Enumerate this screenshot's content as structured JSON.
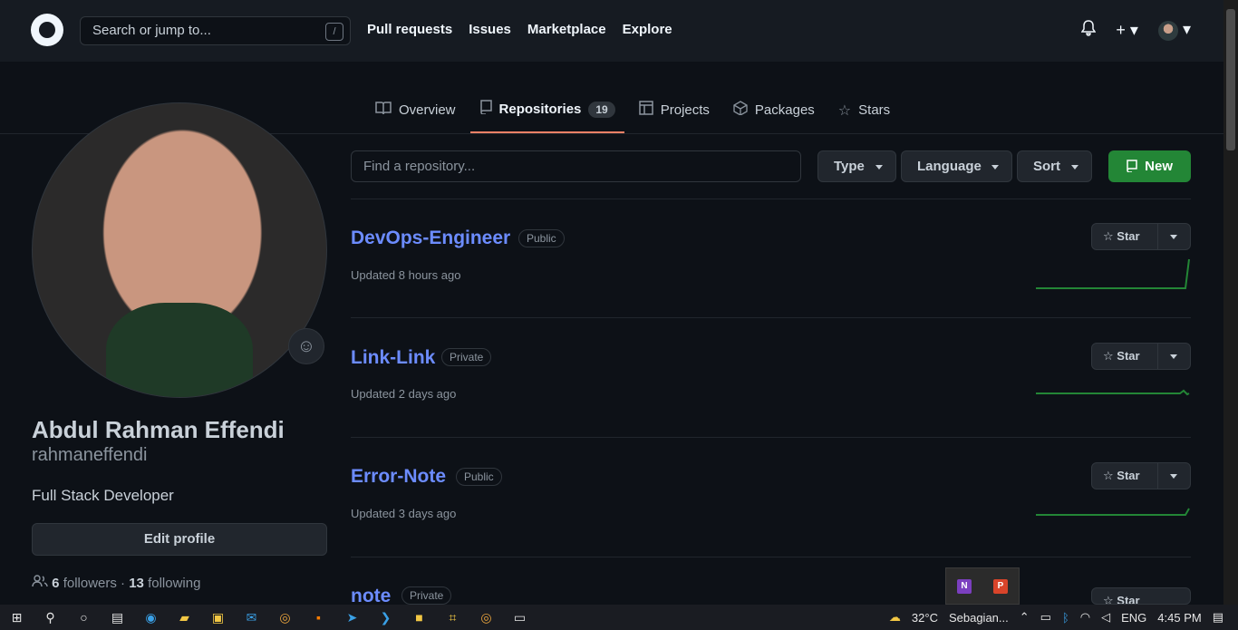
{
  "header": {
    "search_placeholder": "Search or jump to...",
    "slash_key": "/",
    "nav": [
      "Pull requests",
      "Issues",
      "Marketplace",
      "Explore"
    ]
  },
  "tabs": [
    {
      "label": "Overview",
      "icon": "book-icon"
    },
    {
      "label": "Repositories",
      "icon": "repo-icon",
      "count": "19"
    },
    {
      "label": "Projects",
      "icon": "table-icon"
    },
    {
      "label": "Packages",
      "icon": "package-icon"
    },
    {
      "label": "Stars",
      "icon": "star-icon"
    }
  ],
  "profile": {
    "name": "Abdul Rahman Effendi",
    "login": "rahmaneffendi",
    "bio": "Full Stack Developer",
    "edit_label": "Edit profile",
    "followers_count": "6",
    "followers_label": "followers",
    "separator": "·",
    "following_count": "13",
    "following_label": "following"
  },
  "filter": {
    "find_placeholder": "Find a repository...",
    "type_label": "Type",
    "language_label": "Language",
    "sort_label": "Sort",
    "new_label": "New"
  },
  "repos": [
    {
      "name": "DevOps-Engineer",
      "visibility": "Public",
      "updated": "Updated 8 hours ago",
      "star_label": "Star"
    },
    {
      "name": "Link-Link",
      "visibility": "Private",
      "updated": "Updated 2 days ago",
      "star_label": "Star"
    },
    {
      "name": "Error-Note",
      "visibility": "Public",
      "updated": "Updated 3 days ago",
      "star_label": "Star"
    },
    {
      "name": "note",
      "visibility": "Private",
      "updated": "",
      "star_label": "Star"
    }
  ],
  "taskbar": {
    "weather": "32°C",
    "weather_desc": "Sebagian...",
    "lang": "ENG",
    "time": "4:45 PM",
    "popup_icons": [
      "N",
      "P"
    ]
  },
  "colors": {
    "accent_link": "#6c8cff",
    "new_button": "#238636",
    "active_tab_underline": "#f78166"
  }
}
